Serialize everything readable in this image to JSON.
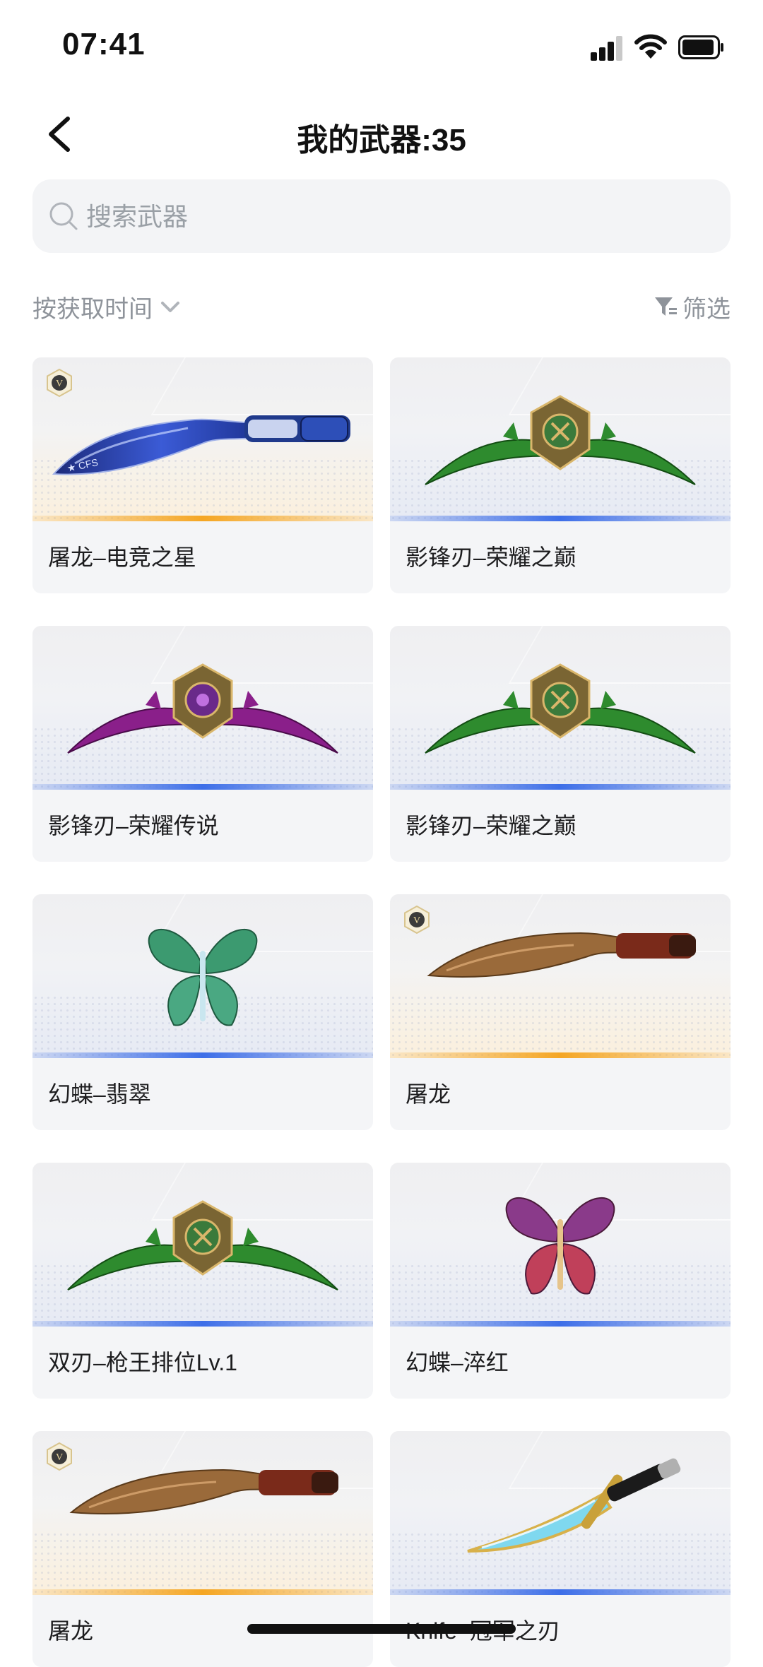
{
  "status_bar": {
    "time": "07:41"
  },
  "header": {
    "title": "我的武器:35"
  },
  "search": {
    "placeholder": "搜索武器",
    "value": ""
  },
  "toolbar": {
    "sort_label": "按获取时间",
    "filter_label": "筛选"
  },
  "colors": {
    "gold_rarity": "#f5a623",
    "blue_rarity": "#3d6ee8",
    "card_bg": "#f4f5f7",
    "muted_text": "#8e939a"
  },
  "weapons": [
    {
      "name": "屠龙–电竞之星",
      "rarity": "gold",
      "badge": "V",
      "art": "kukri-blue"
    },
    {
      "name": "影锋刃–荣耀之巅",
      "rarity": "blue",
      "art": "twinblade-green"
    },
    {
      "name": "影锋刃–荣耀传说",
      "rarity": "blue",
      "art": "twinblade-purple"
    },
    {
      "name": "影锋刃–荣耀之巅",
      "rarity": "blue",
      "art": "twinblade-green"
    },
    {
      "name": "幻蝶–翡翠",
      "rarity": "blue",
      "art": "butterfly-green"
    },
    {
      "name": "屠龙",
      "rarity": "gold",
      "badge": "V",
      "art": "kukri-bronze"
    },
    {
      "name": "双刃–枪王排位Lv.1",
      "rarity": "blue",
      "art": "twinblade-green"
    },
    {
      "name": "幻蝶–淬红",
      "rarity": "blue",
      "art": "butterfly-red"
    },
    {
      "name": "屠龙",
      "rarity": "gold",
      "badge": "V",
      "art": "kukri-bronze"
    },
    {
      "name": "Knife–冠军之刃",
      "rarity": "blue",
      "art": "knife-cyan"
    }
  ]
}
